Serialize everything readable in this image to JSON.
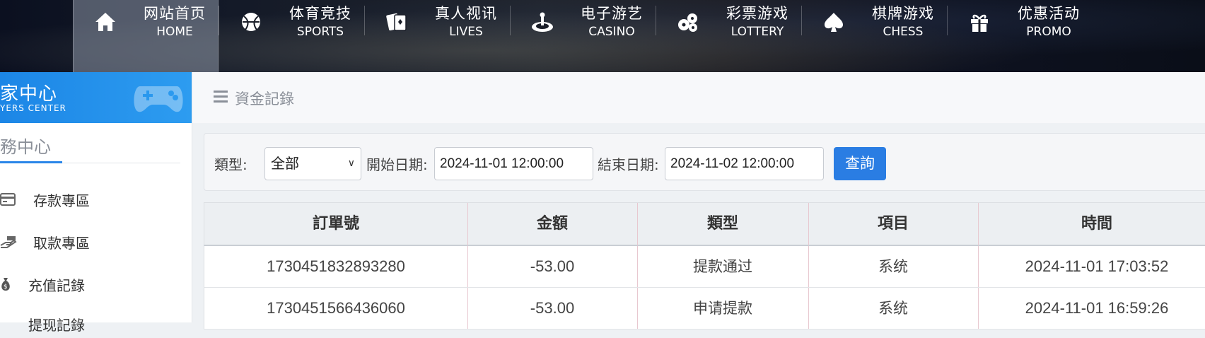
{
  "nav": {
    "items": [
      {
        "zh": "网站首页",
        "en": "HOME",
        "icon": "home-icon",
        "active": true
      },
      {
        "zh": "体育竞技",
        "en": "SPORTS",
        "icon": "basketball-icon"
      },
      {
        "zh": "真人视讯",
        "en": "LIVES",
        "icon": "cards-icon"
      },
      {
        "zh": "电子游艺",
        "en": "CASINO",
        "icon": "roulette-icon"
      },
      {
        "zh": "彩票游戏",
        "en": "LOTTERY",
        "icon": "lottery-balls-icon"
      },
      {
        "zh": "棋牌游戏",
        "en": "CHESS",
        "icon": "spade-icon"
      },
      {
        "zh": "优惠活动",
        "en": "PROMO",
        "icon": "gift-icon"
      }
    ]
  },
  "sidebar": {
    "title": "家中心",
    "subtitle": "YERS CENTER",
    "section": "務中心",
    "items": [
      {
        "label": "存款專區",
        "icon": "card-icon"
      },
      {
        "label": "取款專區",
        "icon": "cash-hand-icon"
      },
      {
        "label": "充值記錄",
        "icon": "money-bag-icon"
      },
      {
        "label": "提现記錄",
        "icon": "record-icon"
      }
    ]
  },
  "breadcrumb": {
    "text": "資金記錄"
  },
  "filter": {
    "type_label": "類型:",
    "type_value": "全部",
    "start_label": "開始日期:",
    "start_value": "2024-11-01 12:00:00",
    "end_label": "結束日期:",
    "end_value": "2024-11-02 12:00:00",
    "query_button": "查詢"
  },
  "table": {
    "columns": [
      "訂單號",
      "金額",
      "類型",
      "項目",
      "時間"
    ],
    "rows": [
      [
        "1730451832893280",
        "-53.00",
        "提款通过",
        "系统",
        "2024-11-01 17:03:52"
      ],
      [
        "1730451566436060",
        "-53.00",
        "申请提款",
        "系统",
        "2024-11-01 16:59:26"
      ]
    ]
  },
  "colors": {
    "accent": "#2a7de3",
    "sidebar_header": "#1c86e6"
  }
}
